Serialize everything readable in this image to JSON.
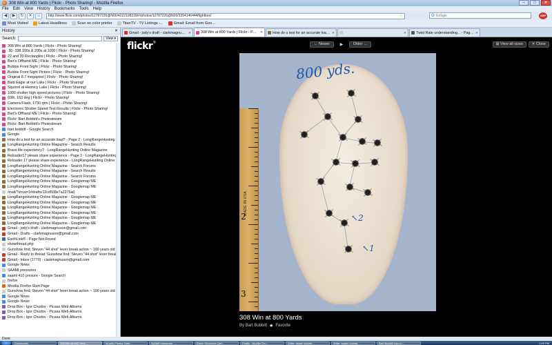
{
  "window": {
    "title": "308 Win at 800 Yards | Flickr - Photo Sharing! - Mozilla Firefox"
  },
  "menu": [
    "File",
    "Edit",
    "View",
    "History",
    "Bookmarks",
    "Tools",
    "Help"
  ],
  "navbar": {
    "url": "http://www.flickr.com/photos/12787226@N00/4222198339/#/photos/12787226@N00/3394146444/lightbox/",
    "search_placeholder": "Google",
    "search_engine_icon": "G"
  },
  "bookmarks": [
    "Most Visited",
    "Latest Headlines",
    "Scan on color printer",
    "TitanTV - TV Listings -...",
    "Gmail: Email from Goo..."
  ],
  "sidebar": {
    "title": "History",
    "search_label": "Search:",
    "view_label": "View",
    "items": [
      {
        "label": "308 Win at 800 Yards | Flickr - Photo Sharing!",
        "color": "#e83e8c"
      },
      {
        "label": ".30-.338 190s & 200s at 1000 | Flickr - Photo Sharing!",
        "color": "#e83e8c"
      },
      {
        "label": "22 and 30 Rectangles | Flickr - Photo Sharing!",
        "color": "#e83e8c"
      },
      {
        "label": "Bart's Offhand ME | Flickr - Photo Sharing!",
        "color": "#e83e8c"
      },
      {
        "label": "Bubble Front Sight | Flickr - Photo Sharing!",
        "color": "#e83e8c"
      },
      {
        "label": "Bubble Front Sight Picture | Flickr - Photo Sharing!",
        "color": "#e83e8c"
      },
      {
        "label": "Original 8.7 megapixel | Flickr - Photo Sharing!",
        "color": "#e83e8c"
      },
      {
        "label": "Bald Eagle at our Lake | Flickr - Photo Sharing!",
        "color": "#e83e8c"
      },
      {
        "label": "Squirrel at Heimicy Lake | Flickr - Photo Sharing!",
        "color": "#e83e8c"
      },
      {
        "label": "1000 shutter high speed pictures | Flickr - Photo Sharing!",
        "color": "#e83e8c"
      },
      {
        "label": "60th, 163 deg | Flickr - Photo Sharing!",
        "color": "#e83e8c"
      },
      {
        "label": "Camera Flash, 1730 rpm | Flickr - Photo Sharing!",
        "color": "#e83e8c"
      },
      {
        "label": "Electronic Shutter Speed Test Results | Flickr - Photo Sharing!",
        "color": "#e83e8c"
      },
      {
        "label": "Bart's Offhand ME | Flickr - Photo Sharing!",
        "color": "#e83e8c"
      },
      {
        "label": "Flickr: Bart Bobbitt's Photostream",
        "color": "#e83e8c"
      },
      {
        "label": "Flickr: Bart Bobbitt's Photostream",
        "color": "#e83e8c"
      },
      {
        "label": "bart bobbitt - Google Search",
        "color": "#4285f4"
      },
      {
        "label": "Google",
        "color": "#4285f4"
      },
      {
        "label": "How do u test for an accurate load? - Page 2 - LongRangeHunting Onl...",
        "color": "#8a6d3b"
      },
      {
        "label": "LongRangeHunting Online Magazine - Search Results",
        "color": "#8a6d3b"
      },
      {
        "label": "Brass life expectency? - LongRangeHunting Online Magazine",
        "color": "#8a6d3b"
      },
      {
        "label": "Reloader17 please share experience - Page 2 - LongRangeHunting Onli...",
        "color": "#8a6d3b"
      },
      {
        "label": "Reloader 17 please share experience - LongRangeHunting Online Ma...",
        "color": "#8a6d3b"
      },
      {
        "label": "LongRangeHunting Online Magazine - Search Forums",
        "color": "#8a6d3b"
      },
      {
        "label": "LongRangeHunting Online Magazine - Search Results",
        "color": "#8a6d3b"
      },
      {
        "label": "LongRangeHunting Online Magazine - Search Forums",
        "color": "#8a6d3b"
      },
      {
        "label": "LongRangeHunting Online Magazine - Googlemap ME",
        "color": "#8a6d3b"
      },
      {
        "label": "LongRangeHunting Online Magazine - Googlemap ME",
        "color": "#8a6d3b"
      },
      {
        "label": "/mail/?shva=1#drafts/12cd508e7a2275a0",
        "color": "#cccccc"
      },
      {
        "label": "LongRangeHunting Online Magazine - Googlemap ME",
        "color": "#8a6d3b"
      },
      {
        "label": "LongRangeHunting Online Magazine - Googlemap ME",
        "color": "#8a6d3b"
      },
      {
        "label": "LongRangeHunting Online Magazine - Googlemap ME",
        "color": "#8a6d3b"
      },
      {
        "label": "LongRangeHunting Online Magazine - Googlemap ME",
        "color": "#8a6d3b"
      },
      {
        "label": "LongRangeHunting Online Magazine - Googlemap ME",
        "color": "#8a6d3b"
      },
      {
        "label": "LongRangeHunting Online Magazine - Googlemap ME",
        "color": "#8a6d3b"
      },
      {
        "label": "Gmail - jody's draft - clarkmagnuson@gmail.com",
        "color": "#d93025"
      },
      {
        "label": "Gmail - Drafts - clarkmagnuson@gmail.com",
        "color": "#d93025"
      },
      {
        "label": "EarthLink® - Page Not Found",
        "color": "#2f6db3"
      },
      {
        "label": "showthread.php",
        "color": "#cccccc"
      },
      {
        "label": "Gunshow find; Steven \"44 shot\" lever break action ~ 100 years old",
        "color": "#cccccc"
      },
      {
        "label": "Gmail - Reply to thread 'Gunshow find; Steven \"44 shot\" lever break ac...",
        "color": "#d93025"
      },
      {
        "label": "Gmail - Inbox (1770) - clarkmagnuson@gmail.com",
        "color": "#d93025"
      },
      {
        "label": "Google News",
        "color": "#4285f4"
      },
      {
        "label": "SAAMI pressures",
        "color": "#cccccc"
      },
      {
        "label": "saami 410 presure - Google Search",
        "color": "#4285f4"
      },
      {
        "label": "firefox",
        "color": "#cccccc"
      },
      {
        "label": "Mozilla Firefox Start Page",
        "color": "#e66000"
      },
      {
        "label": "Gunshow find; Steven \"44 shot\" lever break action ~ 100 years old",
        "color": "#cccccc"
      },
      {
        "label": "Google News",
        "color": "#4285f4"
      },
      {
        "label": "Google News",
        "color": "#4285f4"
      },
      {
        "label": "Drop Box - Igor Chudov - Picasa Web Albums",
        "color": "#7e57c2"
      },
      {
        "label": "Drop Box - Igor Chudov - Picasa Web Albums",
        "color": "#7e57c2"
      },
      {
        "label": "Drop Box - Igor Chudov - Picasa Web Albums",
        "color": "#7e57c2"
      }
    ]
  },
  "tabs": [
    {
      "label": "Gmail - jody's draft - clarkmagnuson...",
      "color": "#d93025",
      "active": false
    },
    {
      "label": "308 Win at 800 Yards | Flickr - Pho...",
      "color": "#e83e8c",
      "active": true
    },
    {
      "label": "How do u test for an accurate load?...",
      "color": "#8a6d3b",
      "active": false
    },
    {
      "label": "",
      "color": "#cccccc",
      "active": false
    },
    {
      "label": "Twist Rate understanding... - Page 2...",
      "color": "#555555",
      "active": false
    }
  ],
  "viewer": {
    "logo": "flickr",
    "newer_label": "← Newer",
    "play_label": "▶",
    "older_label": "Older →",
    "view_all_label": "View all sizes",
    "close_label": "✕ Close",
    "photo_title": "308 Win at 800 Yards",
    "byline": "By Bart Bobbitt",
    "favorite_label": "Favorite",
    "handwriting_title": "800 yds.",
    "handwriting_note1": "2",
    "handwriting_note2": "1",
    "ruler_made": "MADE IN USA",
    "ruler_numbers": [
      "2",
      "3"
    ]
  },
  "status": {
    "text": "Done"
  },
  "taskbar": {
    "items": [
      "Downloads",
      "308 Win at 800 Yard...",
      "Mozilla Firefox Start...",
      "SAAMI pressures - ...",
      "Emco Shopping Cart...",
      "Drafts - Mozilla Thu...",
      "Write: saami chamb...",
      "Write: saami chamb...",
      "Bart Bobbitt icon.jp..."
    ],
    "active_index": 1,
    "clock": "2:09 PM"
  },
  "colors": {
    "flickr_bg": "#000000",
    "photo_bg": "#a5b4cd",
    "handwriting": "#1e5aa8"
  }
}
